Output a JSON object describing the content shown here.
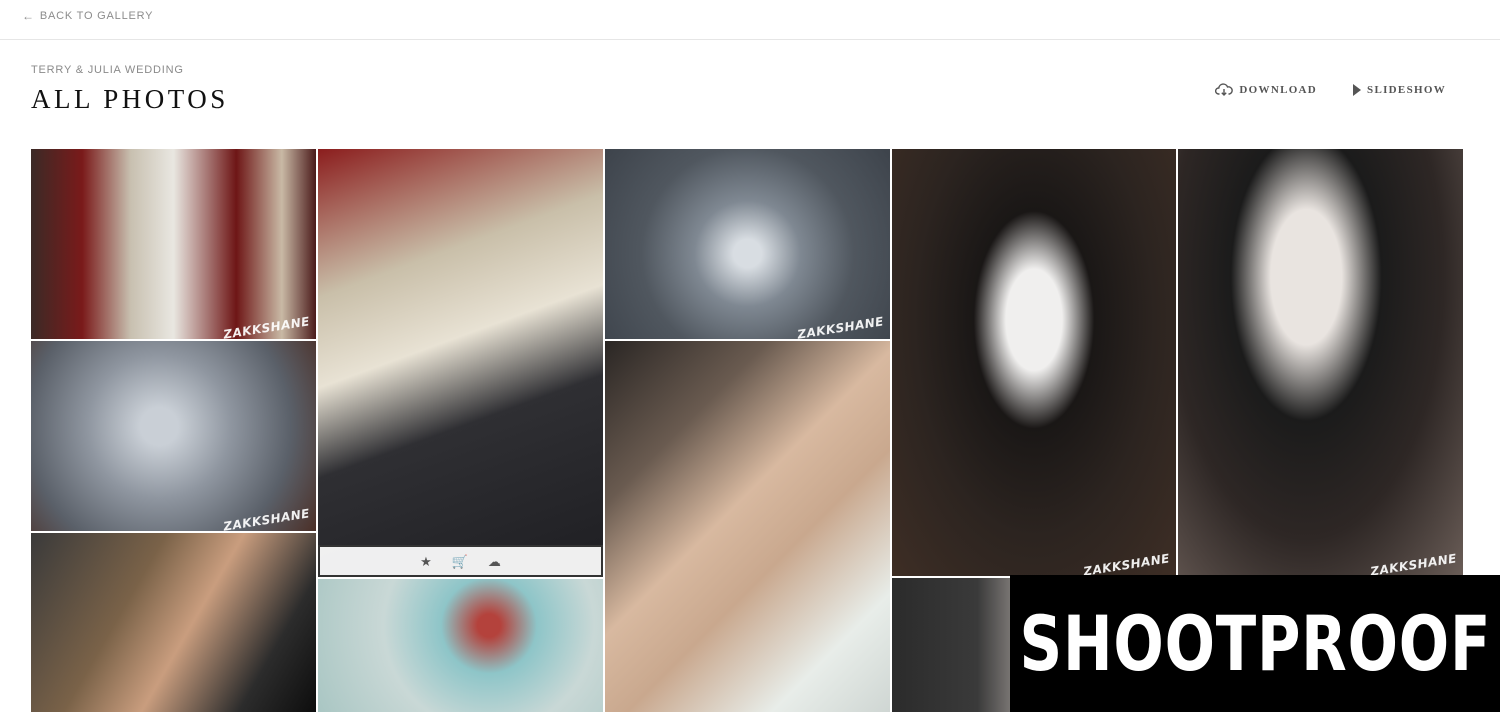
{
  "nav": {
    "back_label": "BACK TO GALLERY",
    "back_icon": "arrow-left-icon"
  },
  "header": {
    "subtitle": "TERRY & JULIA WEDDING",
    "title": "ALL PHOTOS",
    "download_label": "DOWNLOAD",
    "slideshow_label": "SLIDESHOW"
  },
  "photos": [
    {
      "watermark": "ZAKKSHANE"
    },
    {
      "watermark": "ZAKKSHANE"
    },
    {
      "watermark": "ZAKKSHANE"
    },
    {
      "watermark": "ZAKKSHANE"
    },
    {
      "watermark": "ZAKKSHANE"
    },
    {
      "watermark": "ZAKKSHANE"
    },
    {
      "watermark": "ZAKKSHANE"
    }
  ],
  "hover_actions": {
    "favorite": "★",
    "cart": "🛒",
    "download": "☁"
  },
  "brand": {
    "text": "SHOOTPROOF"
  }
}
